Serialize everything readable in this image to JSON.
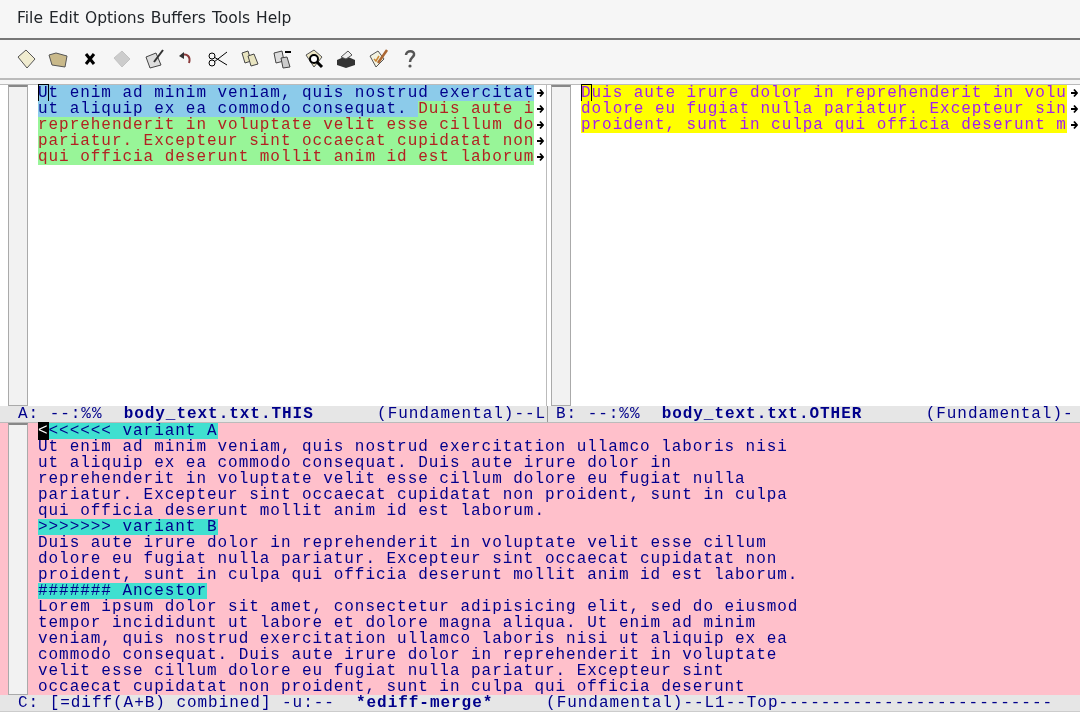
{
  "menu": [
    {
      "label": "File"
    },
    {
      "label": "Edit"
    },
    {
      "label": "Options"
    },
    {
      "label": "Buffers"
    },
    {
      "label": "Tools"
    },
    {
      "label": "Help"
    }
  ],
  "toolbar": [
    {
      "kind": "new",
      "disabled": false
    },
    {
      "kind": "open",
      "disabled": false
    },
    {
      "kind": "close",
      "disabled": false
    },
    {
      "kind": "save",
      "disabled": true
    },
    {
      "kind": "write",
      "disabled": false
    },
    {
      "kind": "undo",
      "disabled": false
    },
    {
      "kind": "cut",
      "disabled": false
    },
    {
      "kind": "copy",
      "disabled": false
    },
    {
      "kind": "paste",
      "disabled": false
    },
    {
      "kind": "search",
      "disabled": false
    },
    {
      "kind": "print",
      "disabled": false
    },
    {
      "kind": "customize",
      "disabled": false
    },
    {
      "kind": "help",
      "disabled": false
    }
  ],
  "windows": [
    {
      "kind": "diff",
      "cursor": true,
      "active": false,
      "lines": [
        {
          "truncated": true,
          "segments": [
            {
              "kind": "current",
              "text": "Ut enim ad minim veniam, quis nostrud exercitat"
            }
          ]
        },
        {
          "truncated": true,
          "segments": [
            {
              "kind": "current",
              "text": "ut aliquip ex ea commodo consequat. "
            },
            {
              "kind": "changed",
              "text": "Duis aute i"
            }
          ]
        },
        {
          "truncated": true,
          "segments": [
            {
              "kind": "changed",
              "text": "reprehenderit in voluptate velit esse cillum do"
            }
          ]
        },
        {
          "truncated": true,
          "segments": [
            {
              "kind": "changed",
              "text": "pariatur. Excepteur sint occaecat cupidatat non"
            }
          ]
        },
        {
          "truncated": true,
          "segments": [
            {
              "kind": "changed",
              "text": "qui officia deserunt mollit anim id est laborum"
            }
          ]
        }
      ],
      "mode_line": {
        "prefix": "A: --:%%  ",
        "buffer": "body_text.txt.THIS",
        "modes": "      (Fundamental)--L"
      }
    },
    {
      "kind": "diff",
      "cursor": true,
      "active": false,
      "lines": [
        {
          "truncated": true,
          "segments": [
            {
              "kind": "other",
              "text": "Duis aute irure dolor in reprehenderit in volu"
            }
          ]
        },
        {
          "truncated": true,
          "segments": [
            {
              "kind": "other",
              "text": "dolore eu fugiat nulla pariatur. Excepteur sin"
            }
          ]
        },
        {
          "truncated": true,
          "segments": [
            {
              "kind": "other",
              "text": "proident, sunt in culpa qui officia deserunt m"
            }
          ]
        }
      ],
      "mode_line": {
        "prefix": "B: --:%%  ",
        "buffer": "body_text.txt.OTHER",
        "modes": "      (Fundamental)-"
      }
    },
    {
      "kind": "merge",
      "cursor": true,
      "active": true,
      "lines": [
        {
          "truncated": false,
          "segments": [
            {
              "kind": "marker",
              "text": "<<<<<<< variant A"
            }
          ]
        },
        {
          "truncated": false,
          "segments": [
            {
              "kind": "plain",
              "text": "Ut enim ad minim veniam, quis nostrud exercitation ullamco laboris nisi"
            }
          ]
        },
        {
          "truncated": false,
          "segments": [
            {
              "kind": "plain",
              "text": "ut aliquip ex ea commodo consequat. Duis aute irure dolor in"
            }
          ]
        },
        {
          "truncated": false,
          "segments": [
            {
              "kind": "plain",
              "text": "reprehenderit in voluptate velit esse cillum dolore eu fugiat nulla"
            }
          ]
        },
        {
          "truncated": false,
          "segments": [
            {
              "kind": "plain",
              "text": "pariatur. Excepteur sint occaecat cupidatat non proident, sunt in culpa"
            }
          ]
        },
        {
          "truncated": false,
          "segments": [
            {
              "kind": "plain",
              "text": "qui officia deserunt mollit anim id est laborum."
            }
          ]
        },
        {
          "truncated": false,
          "segments": [
            {
              "kind": "marker",
              "text": ">>>>>>> variant B"
            }
          ]
        },
        {
          "truncated": false,
          "segments": [
            {
              "kind": "plain",
              "text": "Duis aute irure dolor in reprehenderit in voluptate velit esse cillum"
            }
          ]
        },
        {
          "truncated": false,
          "segments": [
            {
              "kind": "plain",
              "text": "dolore eu fugiat nulla pariatur. Excepteur sint occaecat cupidatat non"
            }
          ]
        },
        {
          "truncated": false,
          "segments": [
            {
              "kind": "plain",
              "text": "proident, sunt in culpa qui officia deserunt mollit anim id est laborum."
            }
          ]
        },
        {
          "truncated": false,
          "segments": [
            {
              "kind": "marker",
              "text": "####### Ancestor"
            }
          ]
        },
        {
          "truncated": false,
          "segments": [
            {
              "kind": "plain",
              "text": "Lorem ipsum dolor sit amet, consectetur adipisicing elit, sed do eiusmod"
            }
          ]
        },
        {
          "truncated": false,
          "segments": [
            {
              "kind": "plain",
              "text": "tempor incididunt ut labore et dolore magna aliqua. Ut enim ad minim"
            }
          ]
        },
        {
          "truncated": false,
          "segments": [
            {
              "kind": "plain",
              "text": "veniam, quis nostrud exercitation ullamco laboris nisi ut aliquip ex ea"
            }
          ]
        },
        {
          "truncated": false,
          "segments": [
            {
              "kind": "plain",
              "text": "commodo consequat. Duis aute irure dolor in reprehenderit in voluptate"
            }
          ]
        },
        {
          "truncated": false,
          "segments": [
            {
              "kind": "plain",
              "text": "velit esse cillum dolore eu fugiat nulla pariatur. Excepteur sint"
            }
          ]
        },
        {
          "truncated": false,
          "segments": [
            {
              "kind": "plain",
              "text": "occaecat cupidatat non proident, sunt in culpa qui officia deserunt"
            }
          ]
        }
      ],
      "mode_line": {
        "prefix": "C: [=diff(A+B) combined] -u:--  ",
        "buffer": "*ediff-merge*",
        "modes": "     (Fundamental)--L1--Top--------------------------"
      }
    }
  ]
}
